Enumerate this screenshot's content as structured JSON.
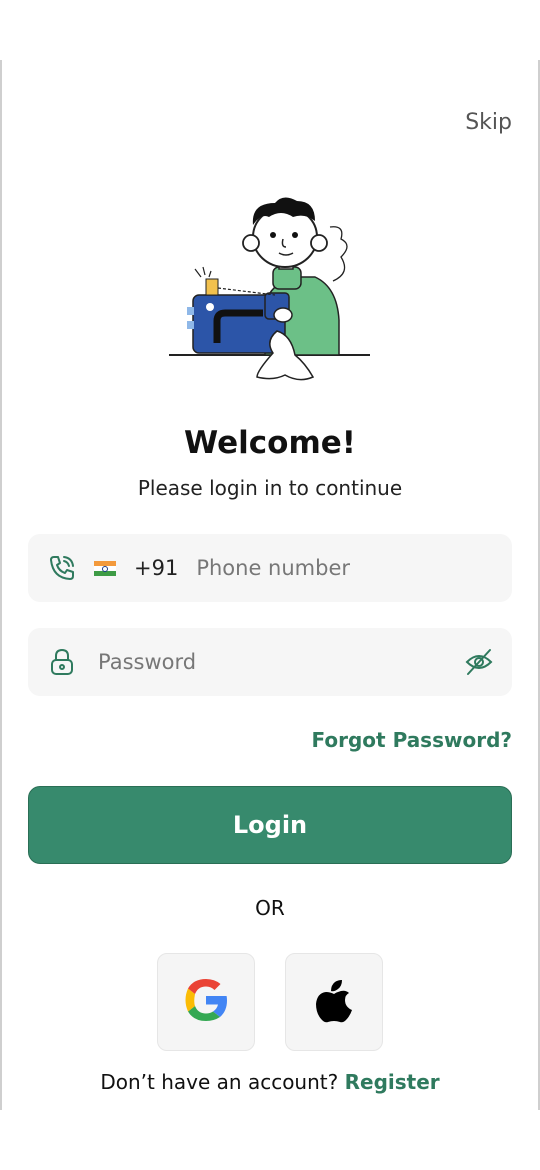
{
  "header": {
    "skip_label": "Skip"
  },
  "illustration": {
    "name": "tailor-sewing-machine-illustration"
  },
  "welcome": {
    "title": "Welcome!",
    "subtitle": "Please login in to continue"
  },
  "phone_field": {
    "icon": "phone-call-icon",
    "flag": "india-flag-icon",
    "country_code": "+91",
    "placeholder": "Phone number",
    "value": ""
  },
  "password_field": {
    "icon": "lock-icon",
    "placeholder": "Password",
    "value": "",
    "toggle_icon": "eye-off-icon"
  },
  "forgot_password_label": "Forgot Password?",
  "login_button_label": "Login",
  "divider_label": "OR",
  "social": {
    "google_icon": "google-icon",
    "apple_icon": "apple-icon"
  },
  "footer": {
    "prompt": "Don’t have an account?",
    "register_label": "Register"
  },
  "colors": {
    "primary": "#378a6d",
    "link": "#2f7a5e",
    "field_bg": "#f6f6f6"
  }
}
